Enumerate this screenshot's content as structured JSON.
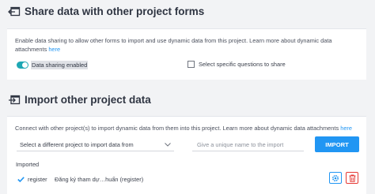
{
  "share": {
    "title": "Share data with other project forms",
    "description": "Enable data sharing to allow other forms to import and use dynamic data from this project. Learn more about dynamic data attachments ",
    "description_link": "here",
    "toggle_label": "Data sharing enabled",
    "toggle_on": true,
    "checkbox_label": "Select specific questions to share",
    "checkbox_checked": false
  },
  "import": {
    "title": "Import other project data",
    "description": "Connect with other project(s) to import dynamic data from them into this project. Learn more about dynamic data attachments ",
    "description_link": "here",
    "select_value": "Select a different project to import data from",
    "name_placeholder": "Give a unique name to the import",
    "import_button": "IMPORT",
    "imported_heading": "Imported",
    "imported_items": [
      {
        "name": "register",
        "source": "Đăng ký tham dự…huấn (register)"
      }
    ]
  },
  "colors": {
    "accent": "#2196f3",
    "toggle": "#1ea7b4",
    "danger": "#e53935"
  }
}
